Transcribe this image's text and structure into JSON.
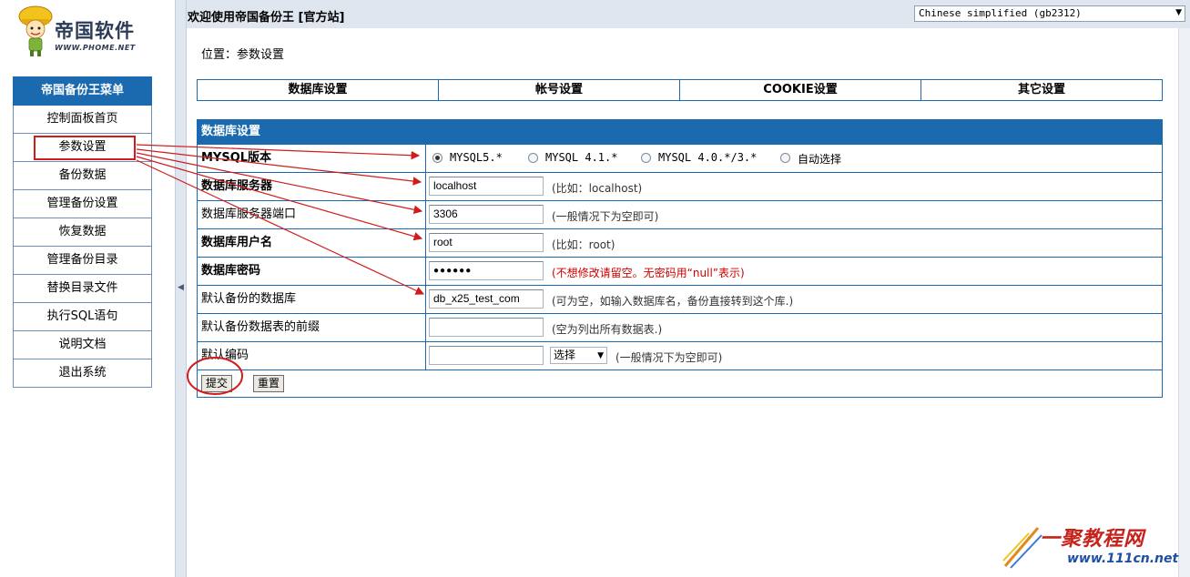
{
  "left": {
    "logo": {
      "brand": "帝国软件",
      "domain": "WWW.PHOME.NET"
    },
    "menu_title": "帝国备份王菜单",
    "menu_items": [
      "控制面板首页",
      "参数设置",
      "备份数据",
      "管理备份设置",
      "恢复数据",
      "管理备份目录",
      "替换目录文件",
      "执行SQL语句",
      "说明文档",
      "退出系统"
    ]
  },
  "topbar": {
    "welcome": "欢迎使用帝国备份王 [官方站]",
    "language_select": "Chinese simplified (gb2312)"
  },
  "content": {
    "location": "位置：参数设置",
    "tabs": [
      "数据库设置",
      "帐号设置",
      "COOKIE设置",
      "其它设置"
    ],
    "form": {
      "header": "数据库设置",
      "mysql_version": {
        "label": "MYSQL版本",
        "options": [
          "MYSQL5.*",
          "MYSQL 4.1.*",
          "MYSQL 4.0.*/3.*",
          "自动选择"
        ],
        "selected": "MYSQL5.*"
      },
      "server": {
        "label": "数据库服务器",
        "value": "localhost",
        "hint": "(比如：localhost)"
      },
      "port": {
        "label": "数据库服务器端口",
        "value": "3306",
        "hint": "(一般情况下为空即可)"
      },
      "user": {
        "label": "数据库用户名",
        "value": "root",
        "hint": "(比如：root)"
      },
      "password": {
        "label": "数据库密码",
        "value": "●●●●●●",
        "hint": "(不想修改请留空。无密码用“null”表示)"
      },
      "default_db": {
        "label": "默认备份的数据库",
        "value": "db_x25_test_com",
        "hint": "(可为空，如输入数据库名，备份直接转到这个库.)"
      },
      "table_prefix": {
        "label": "默认备份数据表的前缀",
        "value": "",
        "hint": "(空为列出所有数据表.)"
      },
      "encoding": {
        "label": "默认编码",
        "value": "",
        "select": "选择",
        "hint": "(一般情况下为空即可)"
      },
      "submit": "提交",
      "reset": "重置"
    }
  },
  "watermark": {
    "title": "一聚教程网",
    "url": "www.111cn.net"
  },
  "colors": {
    "accent": "#1b6ab0",
    "annotation": "#d11c1c",
    "frame": "#dfe6f0"
  }
}
